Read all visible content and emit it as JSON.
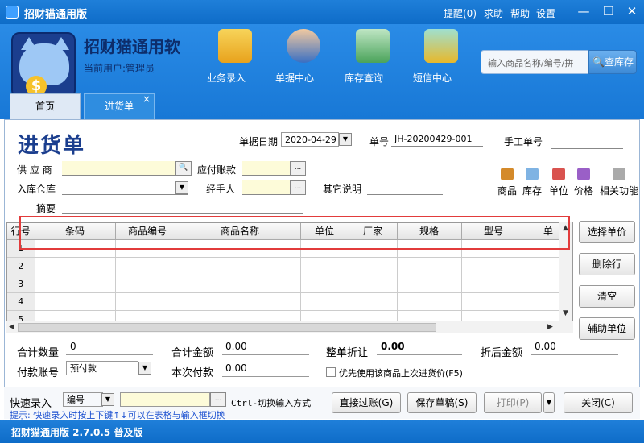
{
  "window": {
    "title": "招财猫通用版",
    "menu": [
      "提醒(0)",
      "求助",
      "帮助",
      "设置"
    ]
  },
  "header": {
    "app_name": "招财猫通用软",
    "current_user": "当前用户:管理员",
    "nav": [
      {
        "label": "业务录入",
        "icon": "truck-icon"
      },
      {
        "label": "单据中心",
        "icon": "user-icon"
      },
      {
        "label": "库存查询",
        "icon": "warehouse-icon"
      },
      {
        "label": "短信中心",
        "icon": "sms-icon"
      }
    ],
    "search_placeholder": "输入商品名称/编号/拼",
    "search_button": "查库存"
  },
  "tabs": [
    {
      "label": "首页"
    },
    {
      "label": "进货单",
      "close": "×"
    }
  ],
  "form": {
    "title": "进货单",
    "date_label": "单据日期",
    "date_value": "2020-04-29",
    "no_label": "单号",
    "no_value": "JH-20200429-001",
    "manual_no_label": "手工单号",
    "supplier_label": "供 应 商",
    "payable_label": "应付账款",
    "warehouse_label": "入库仓库",
    "handler_label": "经手人",
    "other_label": "其它说明",
    "summary_label": "摘要",
    "tools": [
      "商品",
      "库存",
      "单位",
      "价格",
      "相关功能"
    ]
  },
  "grid": {
    "columns": [
      "行号",
      "条码",
      "商品编号",
      "商品名称",
      "单位",
      "厂家",
      "规格",
      "型号",
      "单"
    ],
    "rows": [
      "1",
      "2",
      "3",
      "4",
      "5"
    ]
  },
  "side_buttons": [
    "选择单价",
    "删除行",
    "清空",
    "辅助单位"
  ],
  "totals": {
    "qty_label": "合计数量",
    "qty_value": "0",
    "amount_label": "合计金额",
    "amount_value": "0.00",
    "discount_label": "整单折让",
    "discount_value": "0.00",
    "after_label": "折后金额",
    "after_value": "0.00",
    "account_label": "付款账号",
    "account_value": "预付款",
    "pay_label": "本次付款",
    "pay_value": "0.00",
    "check_label": "优先使用该商品上次进货价(F5)"
  },
  "bottom": {
    "quick_label": "快速录入",
    "quick_mode": "编号",
    "switch_hint": "Ctrl-切换输入方式",
    "buttons": [
      "直接过账(G)",
      "保存草稿(S)",
      "打印(P)",
      "关闭(C)"
    ],
    "hint": "提示: 快速录入时按上下键↑↓可以在表格与输入框切换"
  },
  "status": {
    "text": "招财猫通用版 2.7.0.5 普及版"
  },
  "colors": {
    "titlebar": "#1f7fd9",
    "header": "#2a8be6",
    "highlight_box": "#e23b3b",
    "yellow_field": "#fdfbd9",
    "hint_text": "#1a4fd0"
  }
}
